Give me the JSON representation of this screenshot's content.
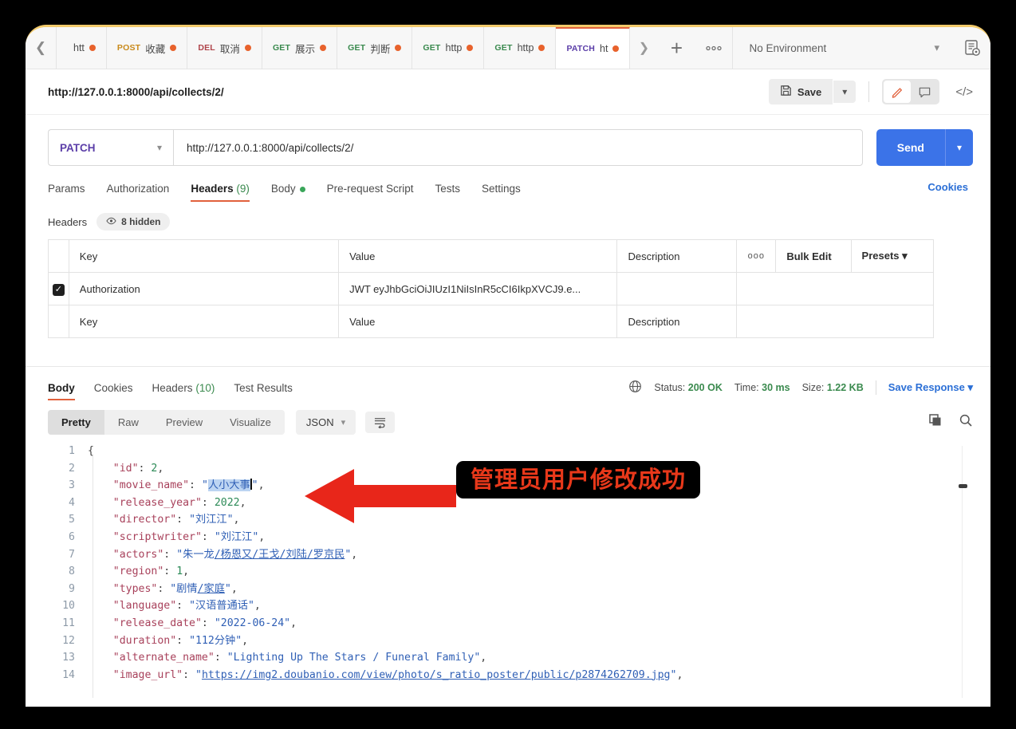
{
  "window": {
    "accent_top_border": "#f2ca6b"
  },
  "tabbar": {
    "back_icon": "chevron-left-icon",
    "next_icon": "chevron-right-icon",
    "plus_icon": "plus-icon",
    "more_icon": "ellipsis-icon",
    "tabs": [
      {
        "verb": "",
        "label": "htt",
        "verb_class": "",
        "dot": "#e8622c"
      },
      {
        "verb": "POST",
        "label": "收藏",
        "verb_class": "verb-post",
        "dot": "#e8622c"
      },
      {
        "verb": "DEL",
        "label": "取消",
        "verb_class": "verb-del",
        "dot": "#e8622c"
      },
      {
        "verb": "GET",
        "label": "展示",
        "verb_class": "verb-get",
        "dot": "#e8622c"
      },
      {
        "verb": "GET",
        "label": "判断",
        "verb_class": "verb-get",
        "dot": "#e8622c"
      },
      {
        "verb": "GET",
        "label": "http",
        "verb_class": "verb-get",
        "dot": "#e8622c"
      },
      {
        "verb": "GET",
        "label": "http",
        "verb_class": "verb-get",
        "dot": "#e8622c"
      },
      {
        "verb": "PATCH",
        "label": "ht",
        "verb_class": "verb-patch",
        "dot": "#e8622c"
      }
    ],
    "environment": "No Environment",
    "env_caret": "chevron-down-icon",
    "env_quick_look_icon": "environment-quick-look-icon"
  },
  "title_row": {
    "request_title": "http://127.0.0.1:8000/api/collects/2/",
    "save_label": "Save",
    "save_icon": "floppy-disk-icon",
    "save_caret": "chevron-down-icon",
    "edit_icon": "pencil-icon",
    "comment_icon": "comment-icon",
    "code_icon": "code-brackets-icon"
  },
  "request": {
    "method": "PATCH",
    "method_caret": "chevron-down-icon",
    "url": "http://127.0.0.1:8000/api/collects/2/",
    "send_label": "Send",
    "send_caret": "chevron-down-icon",
    "send_color": "#3b73e8",
    "tabs": [
      {
        "label": "Params",
        "count": "",
        "active": false,
        "dot": false
      },
      {
        "label": "Authorization",
        "count": "",
        "active": false,
        "dot": false
      },
      {
        "label": "Headers",
        "count": "(9)",
        "active": true,
        "dot": false
      },
      {
        "label": "Body",
        "count": "",
        "active": false,
        "dot": true
      },
      {
        "label": "Pre-request Script",
        "count": "",
        "active": false,
        "dot": false
      },
      {
        "label": "Tests",
        "count": "",
        "active": false,
        "dot": false
      },
      {
        "label": "Settings",
        "count": "",
        "active": false,
        "dot": false
      }
    ],
    "cookies_link": "Cookies",
    "headers_label": "Headers",
    "hidden_pill": "8 hidden",
    "hidden_icon": "eye-icon"
  },
  "headers_table": {
    "columns": [
      "Key",
      "Value",
      "Description"
    ],
    "dots_label": "ooo",
    "bulk_edit_label": "Bulk Edit",
    "presets_label": "Presets",
    "presets_caret": "chevron-down-icon",
    "rows": [
      {
        "checked": true,
        "check_glyph": "✓",
        "key": "Authorization",
        "value": "JWT eyJhbGciOiJIUzI1NiIsInR5cCI6IkpXVCJ9.e...",
        "description": ""
      }
    ],
    "empty_row": {
      "key_placeholder": "Key",
      "value_placeholder": "Value",
      "description_placeholder": "Description"
    }
  },
  "response": {
    "tabs": [
      {
        "label": "Body",
        "count": "",
        "active": true
      },
      {
        "label": "Cookies",
        "count": "",
        "active": false
      },
      {
        "label": "Headers",
        "count": "(10)",
        "active": false
      },
      {
        "label": "Test Results",
        "count": "",
        "active": false
      }
    ],
    "globe_icon": "globe-icon",
    "status_label": "Status:",
    "status_value": "200 OK",
    "time_label": "Time:",
    "time_value": "30 ms",
    "size_label": "Size:",
    "size_value": "1.22 KB",
    "save_response_label": "Save Response",
    "save_response_caret": "chevron-down-icon",
    "view_modes": [
      "Pretty",
      "Raw",
      "Preview",
      "Visualize"
    ],
    "active_view_mode": "Pretty",
    "format": "JSON",
    "format_caret": "chevron-down-icon",
    "wrap_icon": "word-wrap-icon",
    "copy_icon": "copy-icon",
    "search_icon": "search-icon"
  },
  "response_body": {
    "lines": [
      {
        "n": "1",
        "html": "<span class=\"p\">{</span>"
      },
      {
        "n": "2",
        "html": "    <span class=\"k\">\"id\"</span><span class=\"p\">: </span><span class=\"n\">2</span><span class=\"p\">,</span>"
      },
      {
        "n": "3",
        "html": "    <span class=\"k\">\"movie_name\"</span><span class=\"p\">: </span><span class=\"s\">\"<span class=\"sel\">人小大事</span><span class=\"caret-bar\"></span>\"</span><span class=\"p\">,</span>"
      },
      {
        "n": "4",
        "html": "    <span class=\"k\">\"release_year\"</span><span class=\"p\">: </span><span class=\"n\">2022</span><span class=\"p\">,</span>"
      },
      {
        "n": "5",
        "html": "    <span class=\"k\">\"director\"</span><span class=\"p\">: </span><span class=\"s\">\"刘江江\"</span><span class=\"p\">,</span>"
      },
      {
        "n": "6",
        "html": "    <span class=\"k\">\"scriptwriter\"</span><span class=\"p\">: </span><span class=\"s\">\"刘江江\"</span><span class=\"p\">,</span>"
      },
      {
        "n": "7",
        "html": "    <span class=\"k\">\"actors\"</span><span class=\"p\">: </span><span class=\"s\">\"朱一龙<span class=\"u\">/杨恩又/王戈/刘陆/罗京民</span>\"</span><span class=\"p\">,</span>"
      },
      {
        "n": "8",
        "html": "    <span class=\"k\">\"region\"</span><span class=\"p\">: </span><span class=\"n\">1</span><span class=\"p\">,</span>"
      },
      {
        "n": "9",
        "html": "    <span class=\"k\">\"types\"</span><span class=\"p\">: </span><span class=\"s\">\"剧情<span class=\"u\">/家庭</span>\"</span><span class=\"p\">,</span>"
      },
      {
        "n": "10",
        "html": "    <span class=\"k\">\"language\"</span><span class=\"p\">: </span><span class=\"s\">\"汉语普通话\"</span><span class=\"p\">,</span>"
      },
      {
        "n": "11",
        "html": "    <span class=\"k\">\"release_date\"</span><span class=\"p\">: </span><span class=\"s\">\"2022-06-24\"</span><span class=\"p\">,</span>"
      },
      {
        "n": "12",
        "html": "    <span class=\"k\">\"duration\"</span><span class=\"p\">: </span><span class=\"s\">\"112分钟\"</span><span class=\"p\">,</span>"
      },
      {
        "n": "13",
        "html": "    <span class=\"k\">\"alternate_name\"</span><span class=\"p\">: </span><span class=\"s\">\"Lighting Up The Stars / Funeral Family\"</span><span class=\"p\">,</span>"
      },
      {
        "n": "14",
        "html": "    <span class=\"k\">\"image_url\"</span><span class=\"p\">: </span><span class=\"s\">\"<span class=\"u\">https://img2.doubanio.com/view/photo/s_ratio_poster/public/p2874262709.jpg</span>\"</span><span class=\"p\">,</span>"
      }
    ],
    "fields": {
      "id": 2,
      "movie_name": "人小大事",
      "release_year": 2022,
      "director": "刘江江",
      "scriptwriter": "刘江江",
      "actors": "朱一龙/杨恩又/王戈/刘陆/罗京民",
      "region": 1,
      "types": "剧情/家庭",
      "language": "汉语普通话",
      "release_date": "2022-06-24",
      "duration": "112分钟",
      "alternate_name": "Lighting Up The Stars / Funeral Family",
      "image_url": "https://img2.doubanio.com/view/photo/s_ratio_poster/public/p2874262709.jpg"
    }
  },
  "annotations": {
    "callout_text": "管理员用户修改成功",
    "callout_bg": "#000000",
    "callout_color": "#e8381a",
    "arrow_color": "#e8261a",
    "arrow_name": "red-arrow-pointing-left"
  }
}
